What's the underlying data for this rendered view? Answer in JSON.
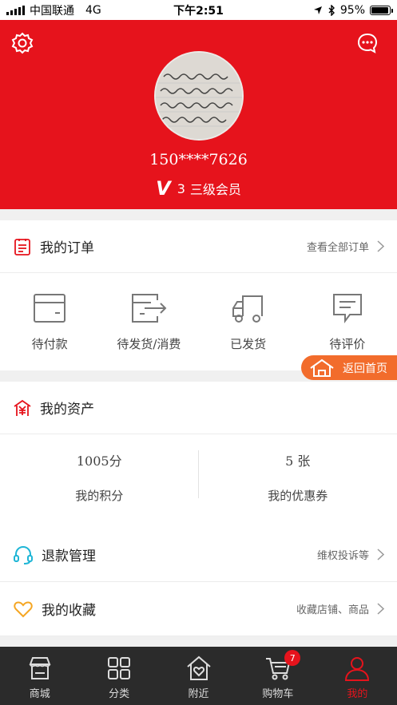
{
  "status_bar": {
    "carrier": "中国联通",
    "network": "4G",
    "time": "下午2:51",
    "battery": "95%",
    "battery_level": 0.95
  },
  "profile": {
    "phone": "150****7626",
    "level_number": "3",
    "level_name": "三级会员"
  },
  "orders": {
    "title": "我的订单",
    "view_all": "查看全部订单",
    "items": [
      {
        "label": "待付款",
        "icon": "wallet-icon"
      },
      {
        "label": "待发货/消费",
        "icon": "ship-box-icon"
      },
      {
        "label": "已发货",
        "icon": "truck-icon"
      },
      {
        "label": "待评价",
        "icon": "comment-icon"
      }
    ]
  },
  "float_button": {
    "label": "返回首页"
  },
  "assets": {
    "title": "我的资产",
    "points_value": "1005分",
    "points_label": "我的积分",
    "coupons_value": "5 张",
    "coupons_label": "我的优惠券"
  },
  "refund": {
    "title": "退款管理",
    "more": "维权投诉等"
  },
  "favorites": {
    "title": "我的收藏",
    "more": "收藏店铺、商品"
  },
  "tabbar": {
    "items": [
      {
        "label": "商城",
        "icon": "store-icon"
      },
      {
        "label": "分类",
        "icon": "grid-icon"
      },
      {
        "label": "附近",
        "icon": "home-heart-icon"
      },
      {
        "label": "购物车",
        "icon": "cart-icon"
      },
      {
        "label": "我的",
        "icon": "person-icon"
      }
    ],
    "cart_badge": "7",
    "active_index": 4
  },
  "colors": {
    "brand_red": "#e6131c",
    "float_orange": "#f26c2c",
    "tabbar_bg": "#2b2b2b",
    "favorite_yellow": "#f5a623",
    "refund_cyan": "#1fb6d6"
  }
}
